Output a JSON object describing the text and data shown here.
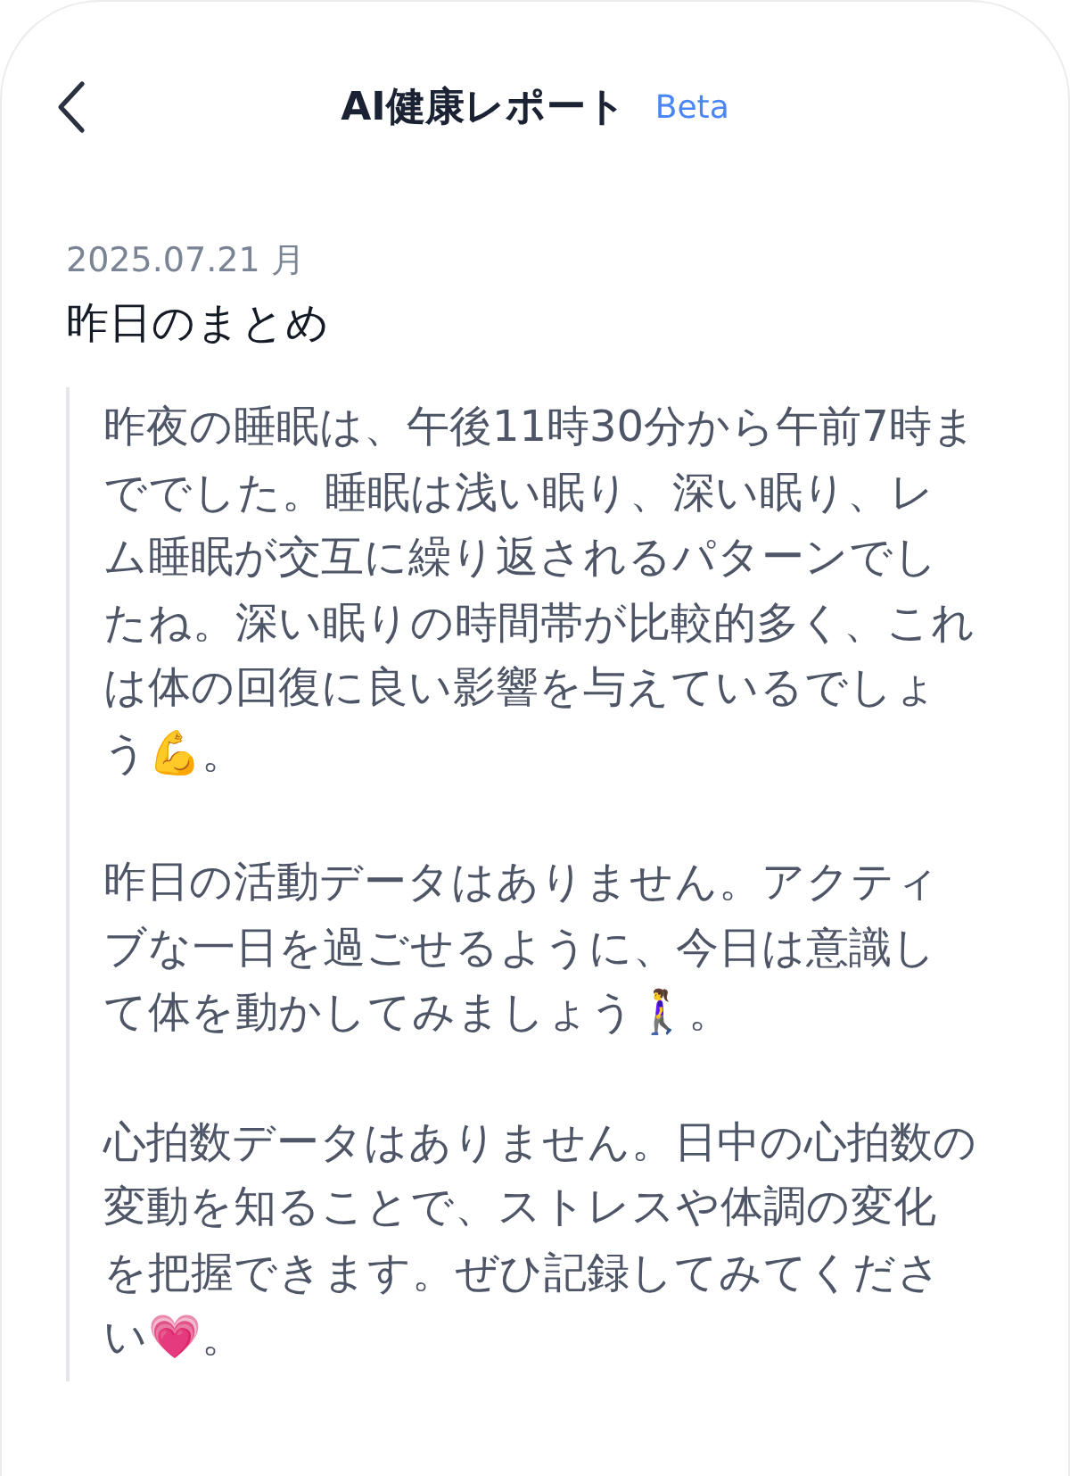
{
  "header": {
    "title": "AI健康レポート",
    "badge": "Beta"
  },
  "report": {
    "date": "2025.07.21 月",
    "heading": "昨日のまとめ",
    "paragraphs": [
      "昨夜の睡眠は、午後11時30分から午前7時まででした。睡眠は浅い眠り、深い眠り、レム睡眠が交互に繰り返されるパターンでしたね。深い眠りの時間帯が比較的多く、これは体の回復に良い影響を与えているでしょう💪。",
      "昨日の活動データはありません。アクティブな一日を過ごせるように、今日は意識して体を動かしてみましょう🚶‍♀️。",
      "心拍数データはありません。日中の心拍数の変動を知ることで、ストレスや体調の変化を把握できます。ぜひ記録してみてください💗。"
    ]
  }
}
